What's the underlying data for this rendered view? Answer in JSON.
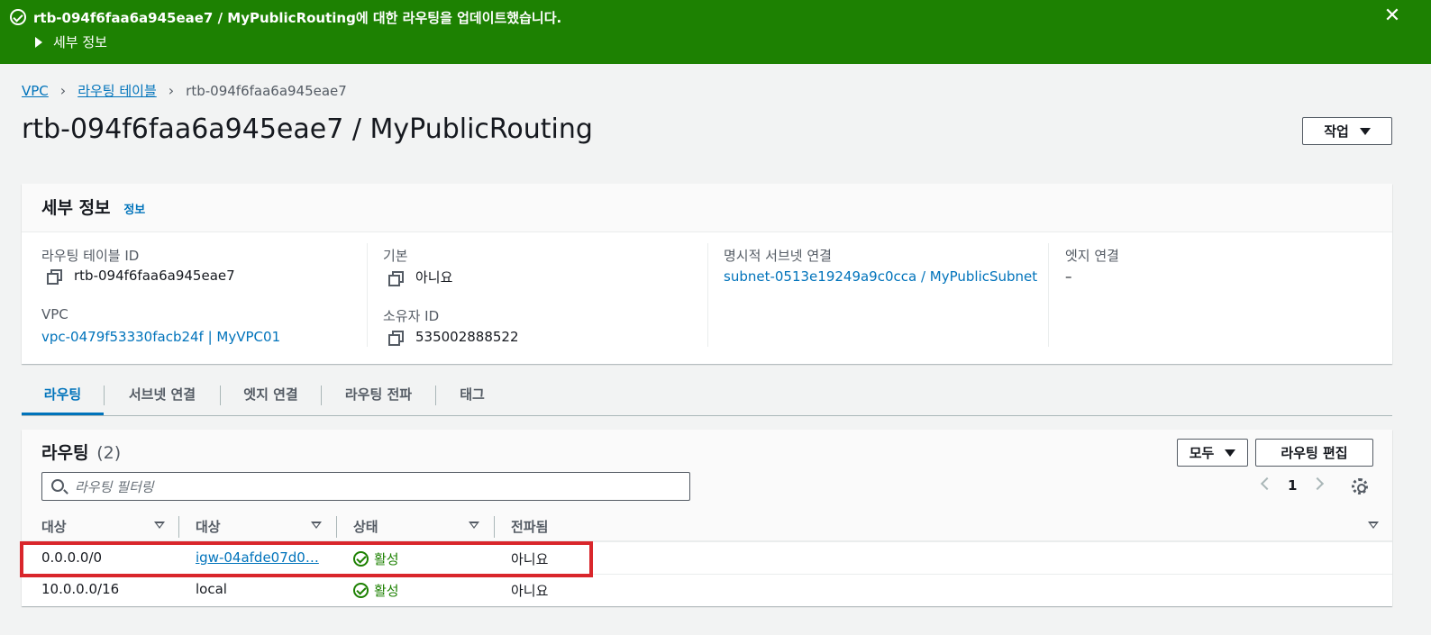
{
  "flash": {
    "message": "rtb-094f6faa6a945eae7 / MyPublicRouting에 대한 라우팅을 업데이트했습니다.",
    "details_label": "세부 정보",
    "close": "✕"
  },
  "breadcrumb": {
    "items": [
      "VPC",
      "라우팅 테이블",
      "rtb-094f6faa6a945eae7"
    ],
    "separator": "›"
  },
  "page": {
    "title": "rtb-094f6faa6a945eae7 / MyPublicRouting",
    "actions_label": "작업"
  },
  "details": {
    "heading": "세부 정보",
    "info_link": "정보",
    "fields": {
      "route_table_id": {
        "label": "라우팅 테이블 ID",
        "value": "rtb-094f6faa6a945eae7"
      },
      "main": {
        "label": "기본",
        "value": "아니요"
      },
      "explicit_subnet": {
        "label": "명시적 서브넷 연결",
        "value": "subnet-0513e19249a9c0cca / MyPublicSubnet"
      },
      "edge": {
        "label": "엣지 연결",
        "value": "–"
      },
      "vpc": {
        "label": "VPC",
        "value": "vpc-0479f53330facb24f | MyVPC01"
      },
      "owner": {
        "label": "소유자 ID",
        "value": "535002888522"
      }
    }
  },
  "tabs": [
    "라우팅",
    "서브넷 연결",
    "엣지 연결",
    "라우팅 전파",
    "태그"
  ],
  "routes": {
    "heading": "라우팅",
    "count": "(2)",
    "filter_select": "모두",
    "edit_button": "라우팅 편집",
    "search_placeholder": "라우팅 필터링",
    "page_number": "1",
    "columns": [
      "대상",
      "대상",
      "상태",
      "전파됨"
    ],
    "rows": [
      {
        "destination": "0.0.0.0/0",
        "target": "igw-04afde07d0…",
        "status": "활성",
        "propagated": "아니요"
      },
      {
        "destination": "10.0.0.0/16",
        "target": "local",
        "status": "활성",
        "propagated": "아니요"
      }
    ]
  },
  "colors": {
    "success": "#1d8102",
    "link": "#0073bb",
    "highlight": "#d9262b"
  }
}
